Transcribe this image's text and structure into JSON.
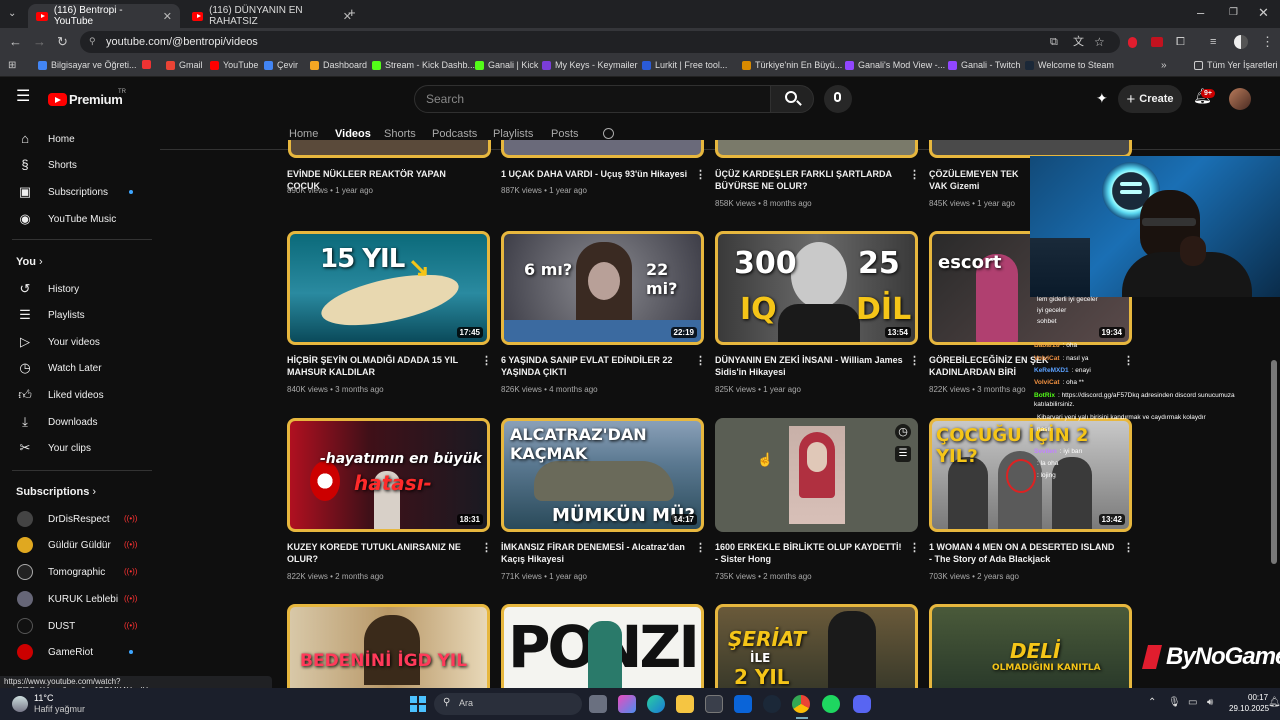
{
  "browser": {
    "tabs": [
      {
        "title": "(116) Bentropi - YouTube",
        "active": true
      },
      {
        "title": "(116) DÜNYANIN EN RAHATSIZ",
        "active": false
      }
    ],
    "url": "youtube.com/@bentropi/videos",
    "bookmarks": [
      "Bilgisayar ve Öğreti...",
      "Gmail",
      "YouTube",
      "Çevir",
      "Dashboard",
      "Stream - Kick Dashb...",
      "Ganali | Kick",
      "My Keys - Keymailer",
      "Lurkit | Free tool...",
      "Türkiye'nin En Büyü...",
      "Ganali's Mod View -...",
      "Ganali - Twitch",
      "Welcome to Steam"
    ],
    "all_bookmarks": "Tüm Yer İşaretleri",
    "status_url": "https://www.youtube.com/watch?v=oEf8Q_X4zsg&pp=0gcJCQMKAYcqIYzv"
  },
  "masthead": {
    "logo": "Premium",
    "logo_tr": "TR",
    "search_placeholder": "Search",
    "create": "Create",
    "notif_badge": "9+"
  },
  "sidebar": {
    "main": [
      "Home",
      "Shorts",
      "Subscriptions",
      "YouTube Music"
    ],
    "you_header": "You",
    "you": [
      "History",
      "Playlists",
      "Your videos",
      "Watch Later",
      "Liked videos",
      "Downloads",
      "Your clips"
    ],
    "subs_header": "Subscriptions",
    "subs": [
      "DrDisRespect",
      "Güldür Güldür",
      "Tomographic",
      "KURUK Leblebi",
      "DUST",
      "GameRiot"
    ]
  },
  "channel_tabs": [
    "Home",
    "Videos",
    "Shorts",
    "Podcasts",
    "Playlists",
    "Posts"
  ],
  "row1": [
    {
      "title": "EVİNDE NÜKLEER REAKTÖR YAPAN ÇOCUK",
      "meta": "890K views • 1 year ago"
    },
    {
      "title": "1 UÇAK DAHA VARDI - Uçuş 93'ün Hikayesi",
      "meta": "887K views • 1 year ago"
    },
    {
      "title": "ÜÇÜZ KARDEŞLER FARKLI ŞARTLARDA BÜYÜRSE NE OLUR?",
      "meta": "858K views • 8 months ago"
    },
    {
      "title": "ÇÖZÜLEMEYEN TEK VAK Gizemi",
      "meta": "845K views • 1 year ago"
    }
  ],
  "row2": [
    {
      "title": "HİÇBİR ŞEYİN OLMADIĞI ADADA 15 YIL MAHSUR KALDILAR",
      "meta": "840K views • 3 months ago",
      "duration": "17:45",
      "thumb_text": [
        "15 YIL"
      ]
    },
    {
      "title": "6 YAŞINDA SANIP EVLAT EDİNDİLER 22 YAŞINDA ÇIKTI",
      "meta": "826K views • 4 months ago",
      "duration": "22:19",
      "thumb_text": [
        "6 mı?",
        "22 mi?"
      ]
    },
    {
      "title": "DÜNYANIN EN ZEKİ İNSANI - William James Sidis'in Hikayesi",
      "meta": "825K views • 1 year ago",
      "duration": "13:54",
      "thumb_text": [
        "300",
        "IQ",
        "25",
        "DİL"
      ]
    },
    {
      "title": "GÖREBİLECEĞİNİZ EN ŞEK KADINLARDAN BİRİ",
      "meta": "822K views • 3 months ago",
      "duration": "19:34",
      "thumb_text": [
        "escort"
      ]
    }
  ],
  "row3": [
    {
      "title": "KUZEY KOREDE TUTUKLANIRSANIZ NE OLUR?",
      "meta": "822K views • 2 months ago",
      "duration": "18:31",
      "thumb_text": [
        "-hayatımın en büyük",
        "hatası-"
      ]
    },
    {
      "title": "İMKANSIZ FİRAR DENEMESİ - Alcatraz'dan Kaçış Hikayesi",
      "meta": "771K views • 1 year ago",
      "duration": "14:17",
      "thumb_text": [
        "ALCATRAZ'DAN KAÇMAK",
        "MÜMKÜN MÜ?"
      ]
    },
    {
      "title": "1600 ERKEKLE BİRLİKTE OLUP KAYDETTİ! - Sister Hong",
      "meta": "735K views • 2 months ago",
      "duration": "",
      "thumb_text": []
    },
    {
      "title": "1 WOMAN 4 MEN ON A DESERTED ISLAND - The Story of Ada Blackjack",
      "meta": "703K views • 2 years ago",
      "duration": "13:42",
      "thumb_text": [
        "ÇOCUĞU İÇİN 2 YIL?"
      ]
    }
  ],
  "row4": [
    {
      "thumb_text": [
        "BEDENİNİ İGD YIL"
      ]
    },
    {
      "thumb_text": [
        "PONZI"
      ]
    },
    {
      "thumb_text": [
        "ŞERİAT",
        "İLE",
        "2 YIL"
      ]
    },
    {
      "thumb_text": [
        "DELİ",
        "OLMADIĞINI KANITLA"
      ]
    }
  ],
  "chat": [
    {
      "user": "",
      "msg": "lem giderli iyi geceler"
    },
    {
      "user": "",
      "msg": "iyi geceler"
    },
    {
      "user": "",
      "msg": "sohbet"
    },
    {
      "user": "",
      "msg": ""
    },
    {
      "user": "Babar28",
      "msg": ": oha"
    },
    {
      "user": "VolviCat",
      "msg": ": nasıl ya"
    },
    {
      "user": "KeReMXD1",
      "msg": ": enayi"
    },
    {
      "user": "VolviCat",
      "msg": ": oha **"
    },
    {
      "user": "BotRix",
      "msg": ": https://discord.gg/aF57Dkq adresinden discord sunucumuza katılabilirsiniz."
    },
    {
      "user": "",
      "msg": "Kibarvari yeni yalı birisini kandırmak ve caydırmak kolaydır"
    },
    {
      "user": "",
      "msg": "nasıl"
    },
    {
      "user": "",
      "msg": ""
    },
    {
      "user": "Sevilen",
      "msg": ": iyi barı"
    },
    {
      "user": "",
      "msg": ": la oha"
    },
    {
      "user": "",
      "msg": ": lojing"
    }
  ],
  "overlay_brand": "ByNoGame",
  "taskbar": {
    "weather_temp": "11°C",
    "weather_desc": "Hafif yağmur",
    "search": "Ara",
    "time": "00:17",
    "date": "29.10.2025"
  }
}
